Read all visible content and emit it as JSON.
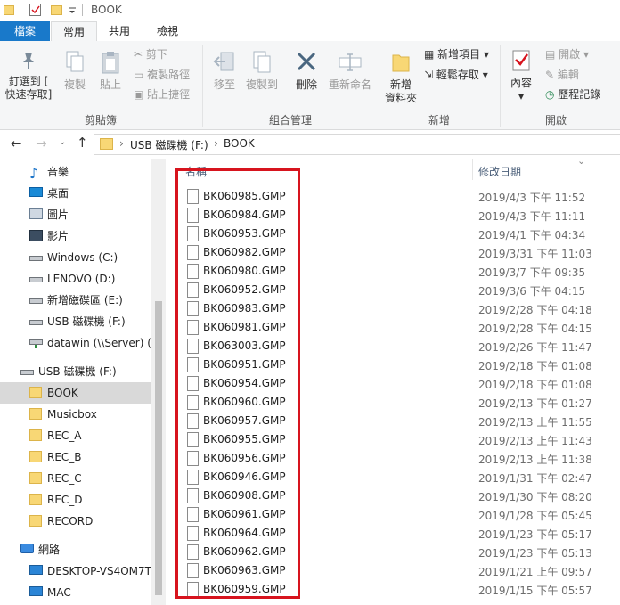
{
  "window": {
    "title": "BOOK"
  },
  "tabs": [
    "檔案",
    "常用",
    "共用",
    "檢視"
  ],
  "ribbon": {
    "clipboard": {
      "pin": "釘選到 [\n快速存取]",
      "copy": "複製",
      "paste": "貼上",
      "cut": "剪下",
      "copy_path": "複製路徑",
      "paste_shortcut": "貼上捷徑",
      "group": "剪貼簿"
    },
    "organize": {
      "move_to": "移至",
      "copy_to": "複製到",
      "delete": "刪除",
      "rename": "重新命名",
      "group": "組合管理"
    },
    "new": {
      "new_folder": "新增\n資料夾",
      "new_item": "新增項目",
      "easy_access": "輕鬆存取",
      "group": "新增"
    },
    "open": {
      "properties": "內容",
      "open": "開啟",
      "edit": "編輯",
      "history": "歷程記錄",
      "group": "開啟"
    }
  },
  "address": {
    "segments": [
      "USB 磁碟機 (F:)",
      "BOOK"
    ]
  },
  "sidebar": [
    {
      "label": "音樂",
      "icon": "music-icon",
      "indent": 1
    },
    {
      "label": "桌面",
      "icon": "desktop-icon",
      "indent": 1
    },
    {
      "label": "圖片",
      "icon": "pictures-icon",
      "indent": 1
    },
    {
      "label": "影片",
      "icon": "videos-icon",
      "indent": 1
    },
    {
      "label": "Windows (C:)",
      "icon": "drive-icon",
      "indent": 1
    },
    {
      "label": "LENOVO (D:)",
      "icon": "drive-icon",
      "indent": 1
    },
    {
      "label": "新增磁碟區 (E:)",
      "icon": "drive-icon",
      "indent": 1
    },
    {
      "label": "USB 磁碟機 (F:)",
      "icon": "usb-drive-icon",
      "indent": 1
    },
    {
      "label": "datawin (\\\\Server) (Z",
      "icon": "network-drive-icon",
      "indent": 1
    },
    {
      "label": "USB 磁碟機 (F:)",
      "icon": "usb-drive-icon",
      "indent": 0
    },
    {
      "label": "BOOK",
      "icon": "folder-icon",
      "indent": 1,
      "selected": true
    },
    {
      "label": "Musicbox",
      "icon": "folder-icon",
      "indent": 1
    },
    {
      "label": "REC_A",
      "icon": "folder-icon",
      "indent": 1
    },
    {
      "label": "REC_B",
      "icon": "folder-icon",
      "indent": 1
    },
    {
      "label": "REC_C",
      "icon": "folder-icon",
      "indent": 1
    },
    {
      "label": "REC_D",
      "icon": "folder-icon",
      "indent": 1
    },
    {
      "label": "RECORD",
      "icon": "folder-icon",
      "indent": 1
    },
    {
      "label": "網路",
      "icon": "network-icon",
      "indent": 0
    },
    {
      "label": "DESKTOP-VS4OM7T",
      "icon": "computer-icon",
      "indent": 1
    },
    {
      "label": "MAC",
      "icon": "computer-icon",
      "indent": 1
    }
  ],
  "columns": {
    "name": "名稱",
    "date": "修改日期"
  },
  "files": [
    {
      "name": "BK060985.GMP",
      "date": "2019/4/3 下午 11:52"
    },
    {
      "name": "BK060984.GMP",
      "date": "2019/4/3 下午 11:11"
    },
    {
      "name": "BK060953.GMP",
      "date": "2019/4/1 下午 04:34"
    },
    {
      "name": "BK060982.GMP",
      "date": "2019/3/31 下午 11:03"
    },
    {
      "name": "BK060980.GMP",
      "date": "2019/3/7 下午 09:35"
    },
    {
      "name": "BK060952.GMP",
      "date": "2019/3/6 下午 04:15"
    },
    {
      "name": "BK060983.GMP",
      "date": "2019/2/28 下午 04:18"
    },
    {
      "name": "BK060981.GMP",
      "date": "2019/2/28 下午 04:15"
    },
    {
      "name": "BK063003.GMP",
      "date": "2019/2/26 下午 11:47"
    },
    {
      "name": "BK060951.GMP",
      "date": "2019/2/18 下午 01:08"
    },
    {
      "name": "BK060954.GMP",
      "date": "2019/2/18 下午 01:08"
    },
    {
      "name": "BK060960.GMP",
      "date": "2019/2/13 下午 01:27"
    },
    {
      "name": "BK060957.GMP",
      "date": "2019/2/13 上午 11:55"
    },
    {
      "name": "BK060955.GMP",
      "date": "2019/2/13 上午 11:43"
    },
    {
      "name": "BK060956.GMP",
      "date": "2019/2/13 上午 11:38"
    },
    {
      "name": "BK060946.GMP",
      "date": "2019/1/31 下午 02:47"
    },
    {
      "name": "BK060908.GMP",
      "date": "2019/1/30 下午 08:20"
    },
    {
      "name": "BK060961.GMP",
      "date": "2019/1/28 下午 05:45"
    },
    {
      "name": "BK060964.GMP",
      "date": "2019/1/23 下午 05:17"
    },
    {
      "name": "BK060962.GMP",
      "date": "2019/1/23 下午 05:13"
    },
    {
      "name": "BK060963.GMP",
      "date": "2019/1/21 上午 09:57"
    },
    {
      "name": "BK060959.GMP",
      "date": "2019/1/15 下午 05:57"
    }
  ],
  "colors": {
    "file_tab": "#1979ca",
    "selection": "#d9d9d9",
    "highlight_box": "#d7141e",
    "folder": "#f8d775"
  }
}
